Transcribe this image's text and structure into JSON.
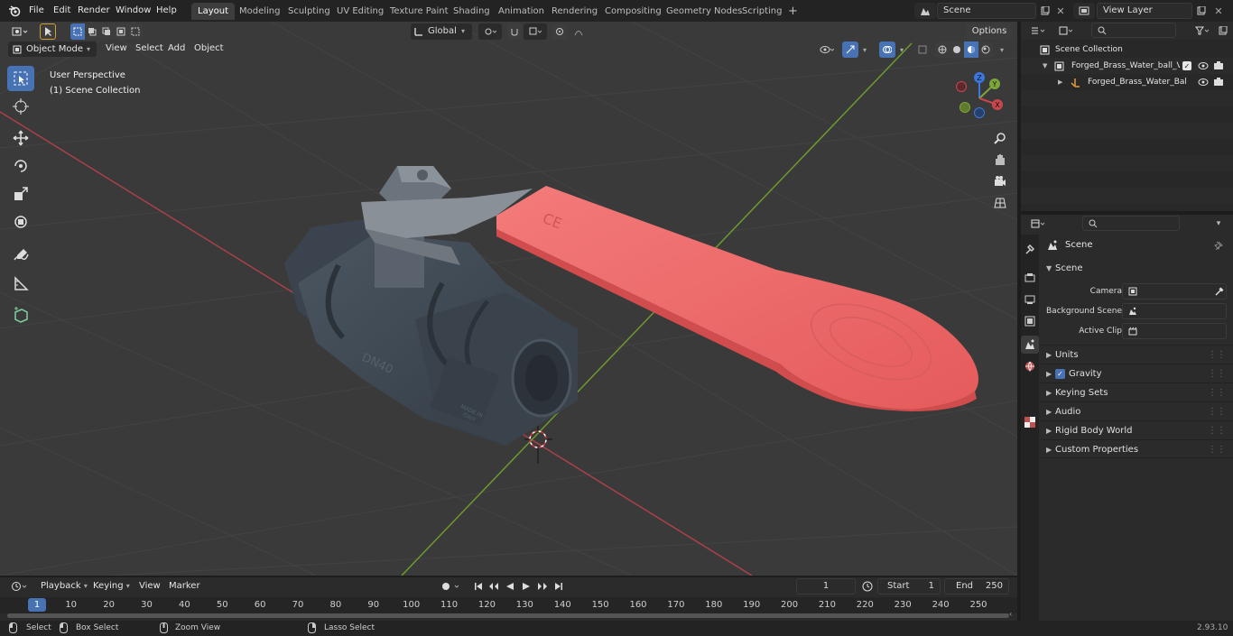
{
  "topbar": {
    "menus": [
      "File",
      "Edit",
      "Render",
      "Window",
      "Help"
    ],
    "workspaces": [
      "Layout",
      "Modeling",
      "Sculpting",
      "UV Editing",
      "Texture Paint",
      "Shading",
      "Animation",
      "Rendering",
      "Compositing",
      "Geometry Nodes",
      "Scripting"
    ],
    "add_workspace": "+",
    "scene": "Scene",
    "view_layer": "View Layer"
  },
  "viewport": {
    "mode": "Object Mode",
    "menus": [
      "View",
      "Select",
      "Add",
      "Object"
    ],
    "orientation": "Global",
    "options": "Options",
    "info_line1": "User Perspective",
    "info_line2": "(1) Scene Collection",
    "gizmo": {
      "z": "Z",
      "y": "Y",
      "x": "X"
    },
    "model_texts": {
      "ce": "CE",
      "made_in": "MADE IN\nITALY"
    }
  },
  "tools": [
    "select-box",
    "cursor",
    "move",
    "rotate",
    "scale",
    "transform",
    "annotate",
    "measure",
    "add-cube"
  ],
  "outliner": {
    "root": "Scene Collection",
    "items": [
      {
        "label": "Forged_Brass_Water_ball_Val",
        "depth": 1
      },
      {
        "label": "Forged_Brass_Water_Bal",
        "depth": 2
      }
    ]
  },
  "properties": {
    "header": "Scene",
    "section": "Scene",
    "fields": [
      {
        "label": "Camera",
        "icon": "camera-icon"
      },
      {
        "label": "Background Scene",
        "icon": "scene-icon"
      },
      {
        "label": "Active Clip",
        "icon": "clip-icon"
      }
    ],
    "panels": [
      "Units",
      "Gravity",
      "Keying Sets",
      "Audio",
      "Rigid Body World",
      "Custom Properties"
    ],
    "gravity_checked": true
  },
  "timeline": {
    "menus": [
      "Playback",
      "Keying",
      "View",
      "Marker"
    ],
    "current_frame": "1",
    "start_label": "Start",
    "start": "1",
    "end_label": "End",
    "end": "250",
    "ticks": [
      "1",
      "10",
      "20",
      "30",
      "40",
      "50",
      "60",
      "70",
      "80",
      "90",
      "100",
      "110",
      "120",
      "130",
      "140",
      "150",
      "160",
      "170",
      "180",
      "190",
      "200",
      "210",
      "220",
      "230",
      "240",
      "250"
    ]
  },
  "statusbar": {
    "items": [
      "Select",
      "Box Select",
      "Zoom View",
      "Lasso Select"
    ],
    "version": "2.93.10"
  },
  "colors": {
    "accent": "#4772b3",
    "handle": "#f06a6a",
    "body": "#3f4852",
    "x_axis": "#c9474b",
    "y_axis": "#7ca63a"
  }
}
